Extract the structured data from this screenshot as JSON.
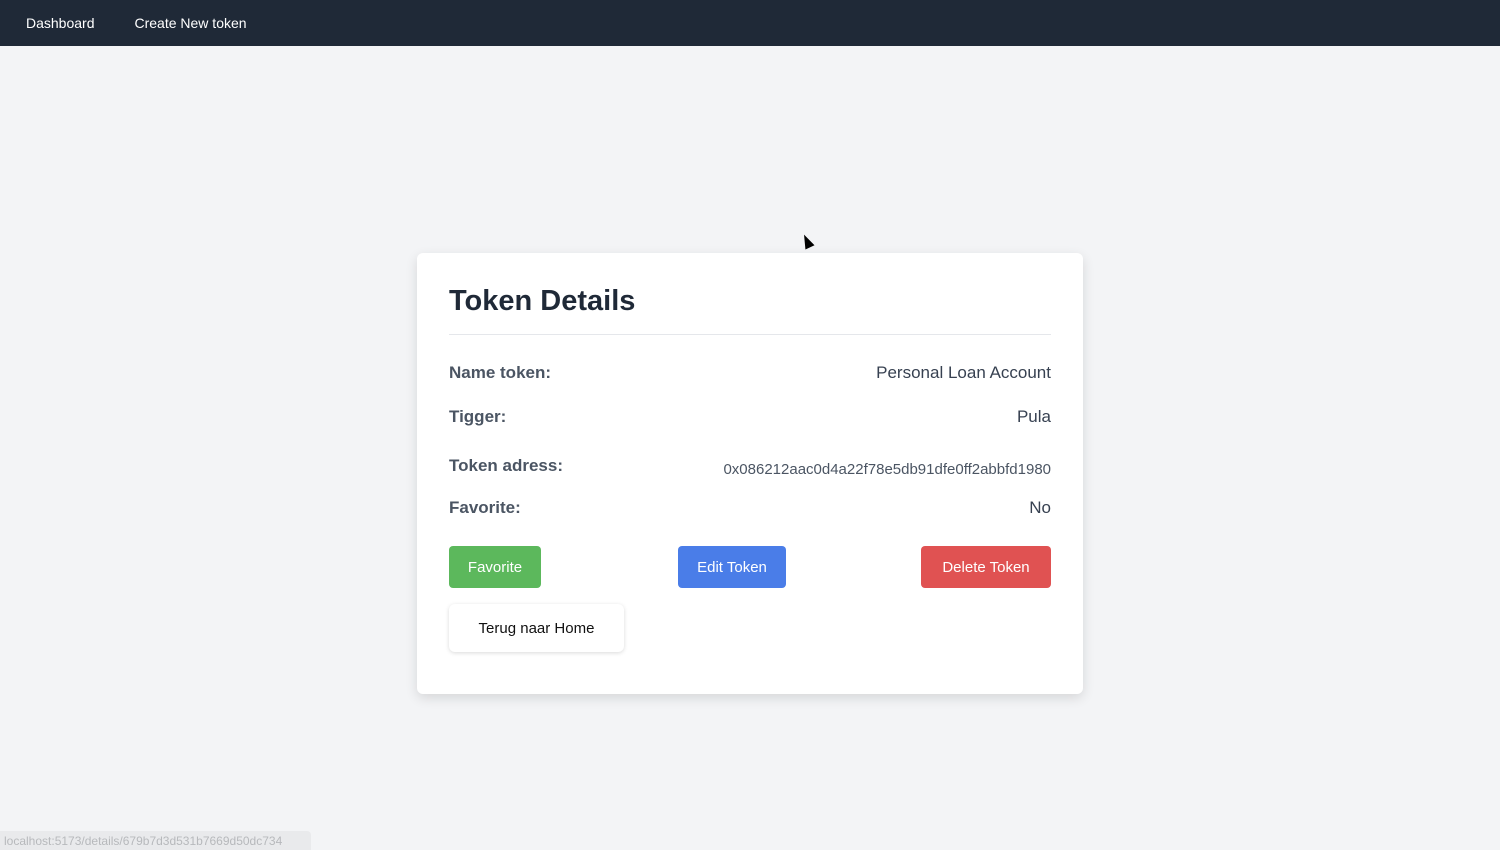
{
  "nav": {
    "dashboard": "Dashboard",
    "create": "Create New token"
  },
  "card": {
    "title": "Token Details",
    "fields": [
      {
        "label": "Name token:",
        "value": "Personal Loan Account"
      },
      {
        "label": "Tigger:",
        "value": "Pula"
      },
      {
        "label": "Token adress:",
        "value": "0x086212aac0d4a22f78e5db91dfe0ff2abbfd1980"
      },
      {
        "label": "Favorite:",
        "value": "No"
      }
    ],
    "buttons": {
      "favorite": "Favorite",
      "edit": "Edit Token",
      "delete": "Delete Token",
      "home": "Terug naar Home"
    }
  },
  "status_url": "localhost:5173/details/679b7d3d531b7669d50dc734",
  "colors": {
    "favorite": "#5cb85c",
    "edit": "#4a7de8",
    "delete": "#e05252",
    "nav": "#1f2937"
  }
}
